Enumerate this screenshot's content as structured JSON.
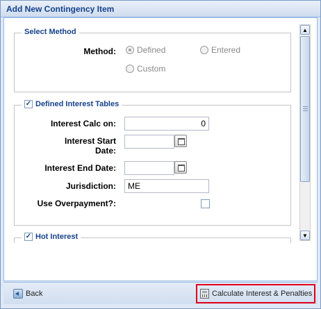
{
  "window": {
    "title": "Add New Contingency Item"
  },
  "select_method": {
    "legend": "Select Method",
    "method_label": "Method:",
    "options": [
      {
        "label": "Defined",
        "selected": true
      },
      {
        "label": "Entered",
        "selected": false
      },
      {
        "label": "Custom",
        "selected": false
      }
    ]
  },
  "defined_interest": {
    "legend": "Defined Interest Tables",
    "checked": true,
    "fields": {
      "calc_on_label": "Interest Calc on:",
      "calc_on_value": "0",
      "start_date_label_1": "Interest Start",
      "start_date_label_2": "Date:",
      "start_date_value": "",
      "end_date_label": "Interest End Date:",
      "end_date_value": "",
      "jurisdiction_label": "Jurisdiction:",
      "jurisdiction_value": "ME",
      "overpayment_label": "Use Overpayment?:",
      "overpayment_checked": false
    }
  },
  "hot_interest": {
    "legend": "Hot Interest",
    "checked": true
  },
  "footer": {
    "back_label": "Back",
    "calculate_label": "Calculate Interest & Penalties"
  },
  "icons": {
    "back": "back-arrow-icon",
    "calculate": "calculator-icon",
    "calendar": "calendar-icon"
  },
  "colors": {
    "highlight": "#e0001b",
    "title_text": "#15428b"
  }
}
